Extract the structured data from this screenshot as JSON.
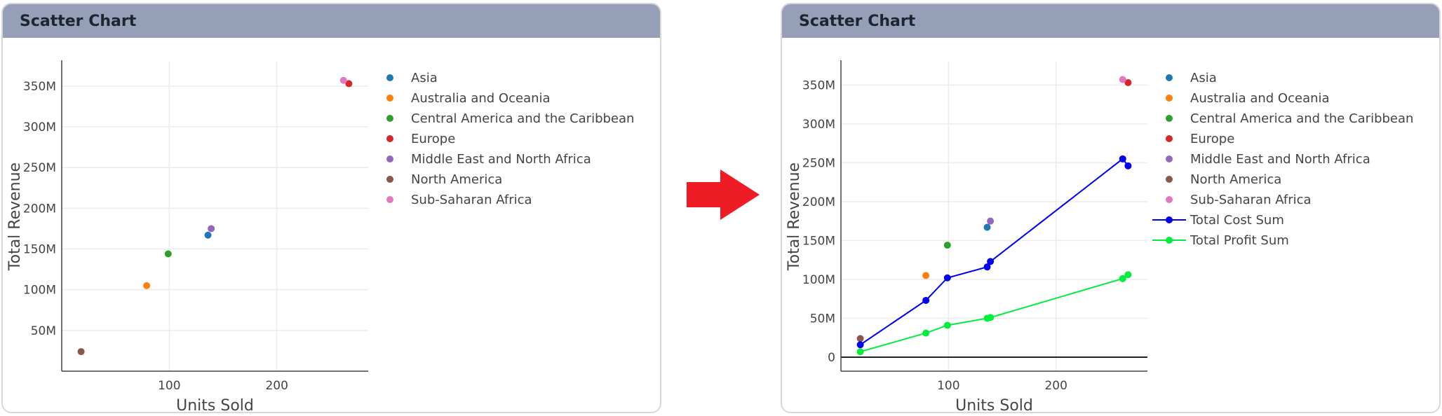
{
  "panels": [
    {
      "title": "Scatter Chart"
    },
    {
      "title": "Scatter Chart"
    }
  ],
  "colors": {
    "header": "#959fb8",
    "arrow": "#ee1c25",
    "grid": "#ebebeb",
    "axis": "#444444"
  },
  "chart_data": [
    {
      "type": "scatter",
      "title": "",
      "xlabel": "Units Sold",
      "ylabel": "Total Revenue",
      "xlim": [
        0,
        285
      ],
      "ylim": [
        0,
        380000000
      ],
      "xticks": [
        {
          "v": 100,
          "label": "100"
        },
        {
          "v": 200,
          "label": "200"
        }
      ],
      "yticks": [
        {
          "v": 50000000,
          "label": "50M"
        },
        {
          "v": 100000000,
          "label": "100M"
        },
        {
          "v": 150000000,
          "label": "150M"
        },
        {
          "v": 200000000,
          "label": "200M"
        },
        {
          "v": 250000000,
          "label": "250M"
        },
        {
          "v": 300000000,
          "label": "300M"
        },
        {
          "v": 350000000,
          "label": "350M"
        }
      ],
      "grid": true,
      "legend": "right",
      "series": [
        {
          "name": "Asia",
          "color": "#1f77b4",
          "mode": "markers",
          "points": [
            [
              136,
              167000000
            ]
          ]
        },
        {
          "name": "Australia and Oceania",
          "color": "#ff7f0e",
          "mode": "markers",
          "points": [
            [
              79,
              105000000
            ]
          ]
        },
        {
          "name": "Central America and the Caribbean",
          "color": "#2ca02c",
          "mode": "markers",
          "points": [
            [
              99,
              144000000
            ]
          ]
        },
        {
          "name": "Europe",
          "color": "#d62728",
          "mode": "markers",
          "points": [
            [
              267,
              353000000
            ]
          ]
        },
        {
          "name": "Middle East and North Africa",
          "color": "#9467bd",
          "mode": "markers",
          "points": [
            [
              139,
              175000000
            ]
          ]
        },
        {
          "name": "North America",
          "color": "#8c564b",
          "mode": "markers",
          "points": [
            [
              18,
              24000000
            ]
          ]
        },
        {
          "name": "Sub-Saharan Africa",
          "color": "#e377c2",
          "mode": "markers",
          "points": [
            [
              262,
              357000000
            ]
          ]
        }
      ]
    },
    {
      "type": "scatter",
      "title": "",
      "xlabel": "Units Sold",
      "ylabel": "Total Revenue",
      "xlim": [
        0,
        285
      ],
      "ylim": [
        -18000000,
        380000000
      ],
      "xticks": [
        {
          "v": 100,
          "label": "100"
        },
        {
          "v": 200,
          "label": "200"
        }
      ],
      "yticks": [
        {
          "v": 0,
          "label": "0"
        },
        {
          "v": 50000000,
          "label": "50M"
        },
        {
          "v": 100000000,
          "label": "100M"
        },
        {
          "v": 150000000,
          "label": "150M"
        },
        {
          "v": 200000000,
          "label": "200M"
        },
        {
          "v": 250000000,
          "label": "250M"
        },
        {
          "v": 300000000,
          "label": "300M"
        },
        {
          "v": 350000000,
          "label": "350M"
        }
      ],
      "grid": true,
      "legend": "right",
      "series": [
        {
          "name": "Asia",
          "color": "#1f77b4",
          "mode": "markers",
          "points": [
            [
              136,
              167000000
            ]
          ]
        },
        {
          "name": "Australia and Oceania",
          "color": "#ff7f0e",
          "mode": "markers",
          "points": [
            [
              79,
              105000000
            ]
          ]
        },
        {
          "name": "Central America and the Caribbean",
          "color": "#2ca02c",
          "mode": "markers",
          "points": [
            [
              99,
              144000000
            ]
          ]
        },
        {
          "name": "Europe",
          "color": "#d62728",
          "mode": "markers",
          "points": [
            [
              267,
              353000000
            ]
          ]
        },
        {
          "name": "Middle East and North Africa",
          "color": "#9467bd",
          "mode": "markers",
          "points": [
            [
              139,
              175000000
            ]
          ]
        },
        {
          "name": "North America",
          "color": "#8c564b",
          "mode": "markers",
          "points": [
            [
              18,
              24000000
            ]
          ]
        },
        {
          "name": "Sub-Saharan Africa",
          "color": "#e377c2",
          "mode": "markers",
          "points": [
            [
              262,
              357000000
            ]
          ]
        },
        {
          "name": "Total Cost Sum",
          "color": "#0000ee",
          "mode": "lines+markers",
          "points": [
            [
              18,
              16000000
            ],
            [
              79,
              73000000
            ],
            [
              99,
              102000000
            ],
            [
              136,
              116000000
            ],
            [
              139,
              123000000
            ],
            [
              262,
              255000000
            ],
            [
              267,
              246000000
            ]
          ]
        },
        {
          "name": "Total Profit Sum",
          "color": "#00ee3c",
          "mode": "lines+markers",
          "points": [
            [
              18,
              7000000
            ],
            [
              79,
              31000000
            ],
            [
              99,
              41000000
            ],
            [
              136,
              50000000
            ],
            [
              139,
              51000000
            ],
            [
              262,
              101000000
            ],
            [
              267,
              106000000
            ]
          ]
        }
      ]
    }
  ]
}
